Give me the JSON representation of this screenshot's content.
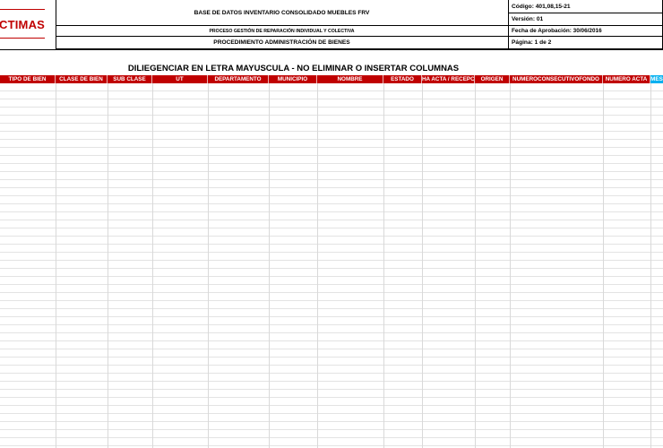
{
  "header": {
    "logo_text": "CTIMAS",
    "title": "BASE DE DATOS INVENTARIO CONSOLIDADO MUEBLES FRV",
    "process": "PROCESO GESTIÓN DE REPARACIÓN INDIVIDUAL Y COLECTIVA",
    "procedure": "PROCEDIMIENTO ADMINISTRACIÓN DE BIENES",
    "code": "Código: 401,08,15-21",
    "version": "Versión: 01",
    "approval_date": "Fecha de Aprobación: 30/06/2016",
    "page": "Página: 1 de 2"
  },
  "sheet_title": "DILIEGENCIAR EN LETRA MAYUSCULA - NO ELIMINAR O INSERTAR COLUMNAS",
  "columns": [
    "TIPO DE BIEN",
    "CLASE DE BIEN",
    "SUB CLASE",
    "UT",
    "DEPARTAMENTO",
    "MUNICIPIO",
    "NOMBRE",
    "ESTADO",
    "HA ACTA / RECEPCI",
    "ORIGEN",
    "NUMEROCONSECUTIVOFONDO",
    "NUMERO ACTA",
    "MES"
  ],
  "colors": {
    "brand_red": "#c00000",
    "header_cyan": "#00b0f0"
  }
}
